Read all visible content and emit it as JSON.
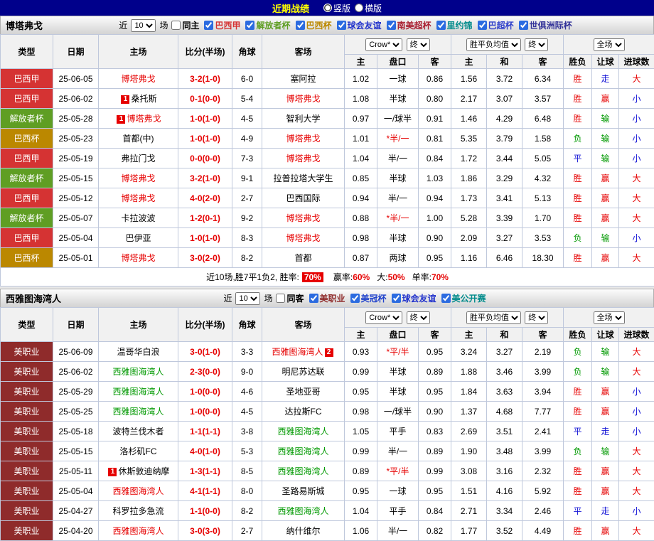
{
  "topbar": {
    "title": "近期战绩",
    "layout_options": [
      {
        "label": "竖版",
        "selected": true
      },
      {
        "label": "横版",
        "selected": false
      }
    ]
  },
  "result_colors": {
    "胜": "#e60000",
    "平": "#1515d6",
    "负": "#009900",
    "赢": "#e60000",
    "走": "#1515d6",
    "输": "#009900",
    "大": "#e60000",
    "小": "#1515d6"
  },
  "league_colors": {
    "巴西甲": "#d53333",
    "解放者杯": "#5f9e23",
    "巴西杯": "#bb8800",
    "美职业": "#8f2b2b"
  },
  "sections": [
    {
      "team": "博塔弗戈",
      "filter": {
        "near_label": "近",
        "count": "10",
        "matches_label": "场",
        "checkboxes": [
          {
            "label": "同主",
            "checked": false,
            "color": "#000000"
          },
          {
            "label": "巴西甲",
            "checked": true,
            "color": "#d53333"
          },
          {
            "label": "解放者杯",
            "checked": true,
            "color": "#5f9e23"
          },
          {
            "label": "巴西杯",
            "checked": true,
            "color": "#bb8800"
          },
          {
            "label": "球会友谊",
            "checked": true,
            "color": "#2233cc"
          },
          {
            "label": "南美超杯",
            "checked": true,
            "color": "#aa2233"
          },
          {
            "label": "里约锦",
            "checked": true,
            "color": "#008b8b"
          },
          {
            "label": "巴超杯",
            "checked": true,
            "color": "#3344cc"
          },
          {
            "label": "世俱洲际杯",
            "checked": true,
            "color": "#333399"
          }
        ]
      },
      "header": {
        "cols": [
          "类型",
          "日期",
          "主场",
          "比分(半场)",
          "角球",
          "客场"
        ],
        "odds_company": "Crow*",
        "odds_stage": "终",
        "avg_label": "胜平负均值",
        "avg_stage": "终",
        "full_label": "全场",
        "sub": [
          "主",
          "盘口",
          "客",
          "主",
          "和",
          "客",
          "胜负",
          "让球",
          "进球数"
        ]
      },
      "rows": [
        {
          "type": "巴西甲",
          "date": "25-06-05",
          "home": {
            "name": "博塔弗戈",
            "color": "#e60000"
          },
          "score": "3-2(1-0)",
          "corners": "6-0",
          "away": {
            "name": "塞阿拉",
            "color": "#000000"
          },
          "ah": {
            "home": "1.02",
            "line": "一球",
            "away": "0.86",
            "star": false
          },
          "euro": [
            "1.56",
            "3.72",
            "6.34"
          ],
          "res": [
            "胜",
            "走",
            "大"
          ]
        },
        {
          "type": "巴西甲",
          "date": "25-06-02",
          "home": {
            "name": "桑托斯",
            "color": "#000000",
            "badge": "1"
          },
          "score": "0-1(0-0)",
          "corners": "5-4",
          "away": {
            "name": "博塔弗戈",
            "color": "#e60000"
          },
          "ah": {
            "home": "1.08",
            "line": "半球",
            "away": "0.80",
            "star": false
          },
          "euro": [
            "2.17",
            "3.07",
            "3.57"
          ],
          "res": [
            "胜",
            "赢",
            "小"
          ]
        },
        {
          "type": "解放者杯",
          "date": "25-05-28",
          "home": {
            "name": "博塔弗戈",
            "color": "#e60000",
            "badge": "1"
          },
          "score": "1-0(1-0)",
          "corners": "4-5",
          "away": {
            "name": "智利大学",
            "color": "#000000"
          },
          "ah": {
            "home": "0.97",
            "line": "一/球半",
            "away": "0.91",
            "star": false
          },
          "euro": [
            "1.46",
            "4.29",
            "6.48"
          ],
          "res": [
            "胜",
            "输",
            "小"
          ]
        },
        {
          "type": "巴西杯",
          "date": "25-05-23",
          "home": {
            "name": "首都(中)",
            "color": "#000000"
          },
          "score": "1-0(1-0)",
          "corners": "4-9",
          "away": {
            "name": "博塔弗戈",
            "color": "#e60000"
          },
          "ah": {
            "home": "1.01",
            "line": "半/一",
            "away": "0.81",
            "star": true
          },
          "euro": [
            "5.35",
            "3.79",
            "1.58"
          ],
          "res": [
            "负",
            "输",
            "小"
          ]
        },
        {
          "type": "巴西甲",
          "date": "25-05-19",
          "home": {
            "name": "弗拉门戈",
            "color": "#000000"
          },
          "score": "0-0(0-0)",
          "corners": "7-3",
          "away": {
            "name": "博塔弗戈",
            "color": "#e60000"
          },
          "ah": {
            "home": "1.04",
            "line": "半/一",
            "away": "0.84",
            "star": false
          },
          "euro": [
            "1.72",
            "3.44",
            "5.05"
          ],
          "res": [
            "平",
            "输",
            "小"
          ]
        },
        {
          "type": "解放者杯",
          "date": "25-05-15",
          "home": {
            "name": "博塔弗戈",
            "color": "#e60000"
          },
          "score": "3-2(1-0)",
          "corners": "9-1",
          "away": {
            "name": "拉普拉塔大学生",
            "color": "#000000"
          },
          "ah": {
            "home": "0.85",
            "line": "半球",
            "away": "1.03",
            "star": false
          },
          "euro": [
            "1.86",
            "3.29",
            "4.32"
          ],
          "res": [
            "胜",
            "赢",
            "大"
          ]
        },
        {
          "type": "巴西甲",
          "date": "25-05-12",
          "home": {
            "name": "博塔弗戈",
            "color": "#e60000"
          },
          "score": "4-0(2-0)",
          "corners": "2-7",
          "away": {
            "name": "巴西国际",
            "color": "#000000"
          },
          "ah": {
            "home": "0.94",
            "line": "半/一",
            "away": "0.94",
            "star": false
          },
          "euro": [
            "1.73",
            "3.41",
            "5.13"
          ],
          "res": [
            "胜",
            "赢",
            "大"
          ]
        },
        {
          "type": "解放者杯",
          "date": "25-05-07",
          "home": {
            "name": "卡拉波波",
            "color": "#000000"
          },
          "score": "1-2(0-1)",
          "corners": "9-2",
          "away": {
            "name": "博塔弗戈",
            "color": "#e60000"
          },
          "ah": {
            "home": "0.88",
            "line": "半/一",
            "away": "1.00",
            "star": true
          },
          "euro": [
            "5.28",
            "3.39",
            "1.70"
          ],
          "res": [
            "胜",
            "赢",
            "大"
          ]
        },
        {
          "type": "巴西甲",
          "date": "25-05-04",
          "home": {
            "name": "巴伊亚",
            "color": "#000000"
          },
          "score": "1-0(1-0)",
          "corners": "8-3",
          "away": {
            "name": "博塔弗戈",
            "color": "#e60000"
          },
          "ah": {
            "home": "0.98",
            "line": "半球",
            "away": "0.90",
            "star": false
          },
          "euro": [
            "2.09",
            "3.27",
            "3.53"
          ],
          "res": [
            "负",
            "输",
            "小"
          ]
        },
        {
          "type": "巴西杯",
          "date": "25-05-01",
          "home": {
            "name": "博塔弗戈",
            "color": "#e60000"
          },
          "score": "3-0(2-0)",
          "corners": "8-2",
          "away": {
            "name": "首都",
            "color": "#000000"
          },
          "ah": {
            "home": "0.87",
            "line": "两球",
            "away": "0.95",
            "star": false
          },
          "euro": [
            "1.16",
            "6.46",
            "18.30"
          ],
          "res": [
            "胜",
            "赢",
            "大"
          ]
        }
      ],
      "summary": {
        "prefix": "近10场,胜7平1负2, 胜率:",
        "rate": "70%",
        "extras": [
          {
            "label": "赢率:",
            "value": "60%"
          },
          {
            "label": "大:",
            "value": "50%"
          },
          {
            "label": "单率:",
            "value": "70%"
          }
        ]
      }
    },
    {
      "team": "西雅图海湾人",
      "filter": {
        "near_label": "近",
        "count": "10",
        "matches_label": "场",
        "checkboxes": [
          {
            "label": "同客",
            "checked": false,
            "color": "#000000"
          },
          {
            "label": "美职业",
            "checked": true,
            "color": "#8f2b2b"
          },
          {
            "label": "美冠杯",
            "checked": true,
            "color": "#2244cc"
          },
          {
            "label": "球会友谊",
            "checked": true,
            "color": "#2233cc"
          },
          {
            "label": "美公开赛",
            "checked": true,
            "color": "#008b8b"
          }
        ]
      },
      "header": {
        "cols": [
          "类型",
          "日期",
          "主场",
          "比分(半场)",
          "角球",
          "客场"
        ],
        "odds_company": "Crow*",
        "odds_stage": "终",
        "avg_label": "胜平负均值",
        "avg_stage": "终",
        "full_label": "全场",
        "sub": [
          "主",
          "盘口",
          "客",
          "主",
          "和",
          "客",
          "胜负",
          "让球",
          "进球数"
        ]
      },
      "rows": [
        {
          "type": "美职业",
          "date": "25-06-09",
          "home": {
            "name": "温哥华白浪",
            "color": "#000000"
          },
          "score": "3-0(1-0)",
          "corners": "3-3",
          "away": {
            "name": "西雅图海湾人",
            "color": "#e60000",
            "badge": "2",
            "badge_after": true
          },
          "ah": {
            "home": "0.93",
            "line": "平/半",
            "away": "0.95",
            "star": true
          },
          "euro": [
            "3.24",
            "3.27",
            "2.19"
          ],
          "res": [
            "负",
            "输",
            "大"
          ]
        },
        {
          "type": "美职业",
          "date": "25-06-02",
          "home": {
            "name": "西雅图海湾人",
            "color": "#009900"
          },
          "score": "2-3(0-0)",
          "corners": "9-0",
          "away": {
            "name": "明尼苏达联",
            "color": "#000000"
          },
          "ah": {
            "home": "0.99",
            "line": "半球",
            "away": "0.89",
            "star": false
          },
          "euro": [
            "1.88",
            "3.46",
            "3.99"
          ],
          "res": [
            "负",
            "输",
            "大"
          ]
        },
        {
          "type": "美职业",
          "date": "25-05-29",
          "home": {
            "name": "西雅图海湾人",
            "color": "#009900"
          },
          "score": "1-0(0-0)",
          "corners": "4-6",
          "away": {
            "name": "圣地亚哥",
            "color": "#000000"
          },
          "ah": {
            "home": "0.95",
            "line": "半球",
            "away": "0.95",
            "star": false
          },
          "euro": [
            "1.84",
            "3.63",
            "3.94"
          ],
          "res": [
            "胜",
            "赢",
            "小"
          ]
        },
        {
          "type": "美职业",
          "date": "25-05-25",
          "home": {
            "name": "西雅图海湾人",
            "color": "#009900"
          },
          "score": "1-0(0-0)",
          "corners": "4-5",
          "away": {
            "name": "达拉斯FC",
            "color": "#000000"
          },
          "ah": {
            "home": "0.98",
            "line": "一/球半",
            "away": "0.90",
            "star": false
          },
          "euro": [
            "1.37",
            "4.68",
            "7.77"
          ],
          "res": [
            "胜",
            "赢",
            "小"
          ]
        },
        {
          "type": "美职业",
          "date": "25-05-18",
          "home": {
            "name": "波特兰伐木者",
            "color": "#000000"
          },
          "score": "1-1(1-1)",
          "corners": "3-8",
          "away": {
            "name": "西雅图海湾人",
            "color": "#009900"
          },
          "ah": {
            "home": "1.05",
            "line": "平手",
            "away": "0.83",
            "star": false
          },
          "euro": [
            "2.69",
            "3.51",
            "2.41"
          ],
          "res": [
            "平",
            "走",
            "小"
          ]
        },
        {
          "type": "美职业",
          "date": "25-05-15",
          "home": {
            "name": "洛杉矶FC",
            "color": "#000000"
          },
          "score": "4-0(1-0)",
          "corners": "5-3",
          "away": {
            "name": "西雅图海湾人",
            "color": "#009900"
          },
          "ah": {
            "home": "0.99",
            "line": "半/一",
            "away": "0.89",
            "star": false
          },
          "euro": [
            "1.90",
            "3.48",
            "3.99"
          ],
          "res": [
            "负",
            "输",
            "大"
          ]
        },
        {
          "type": "美职业",
          "date": "25-05-11",
          "home": {
            "name": "休斯敦迪纳摩",
            "color": "#000000",
            "badge": "1"
          },
          "score": "1-3(1-1)",
          "corners": "8-5",
          "away": {
            "name": "西雅图海湾人",
            "color": "#009900"
          },
          "ah": {
            "home": "0.89",
            "line": "平/半",
            "away": "0.99",
            "star": true
          },
          "euro": [
            "3.08",
            "3.16",
            "2.32"
          ],
          "res": [
            "胜",
            "赢",
            "大"
          ]
        },
        {
          "type": "美职业",
          "date": "25-05-04",
          "home": {
            "name": "西雅图海湾人",
            "color": "#e60000"
          },
          "score": "4-1(1-1)",
          "corners": "8-0",
          "away": {
            "name": "圣路易斯城",
            "color": "#000000"
          },
          "ah": {
            "home": "0.95",
            "line": "一球",
            "away": "0.95",
            "star": false
          },
          "euro": [
            "1.51",
            "4.16",
            "5.92"
          ],
          "res": [
            "胜",
            "赢",
            "大"
          ]
        },
        {
          "type": "美职业",
          "date": "25-04-27",
          "home": {
            "name": "科罗拉多急流",
            "color": "#000000"
          },
          "score": "1-1(0-0)",
          "corners": "8-2",
          "away": {
            "name": "西雅图海湾人",
            "color": "#009900"
          },
          "ah": {
            "home": "1.04",
            "line": "平手",
            "away": "0.84",
            "star": false
          },
          "euro": [
            "2.71",
            "3.34",
            "2.46"
          ],
          "res": [
            "平",
            "走",
            "小"
          ]
        },
        {
          "type": "美职业",
          "date": "25-04-20",
          "home": {
            "name": "西雅图海湾人",
            "color": "#e60000"
          },
          "score": "3-0(3-0)",
          "corners": "2-7",
          "away": {
            "name": "纳什维尔",
            "color": "#000000"
          },
          "ah": {
            "home": "1.06",
            "line": "半/一",
            "away": "0.82",
            "star": false
          },
          "euro": [
            "1.77",
            "3.52",
            "4.49"
          ],
          "res": [
            "胜",
            "赢",
            "大"
          ]
        }
      ]
    }
  ]
}
